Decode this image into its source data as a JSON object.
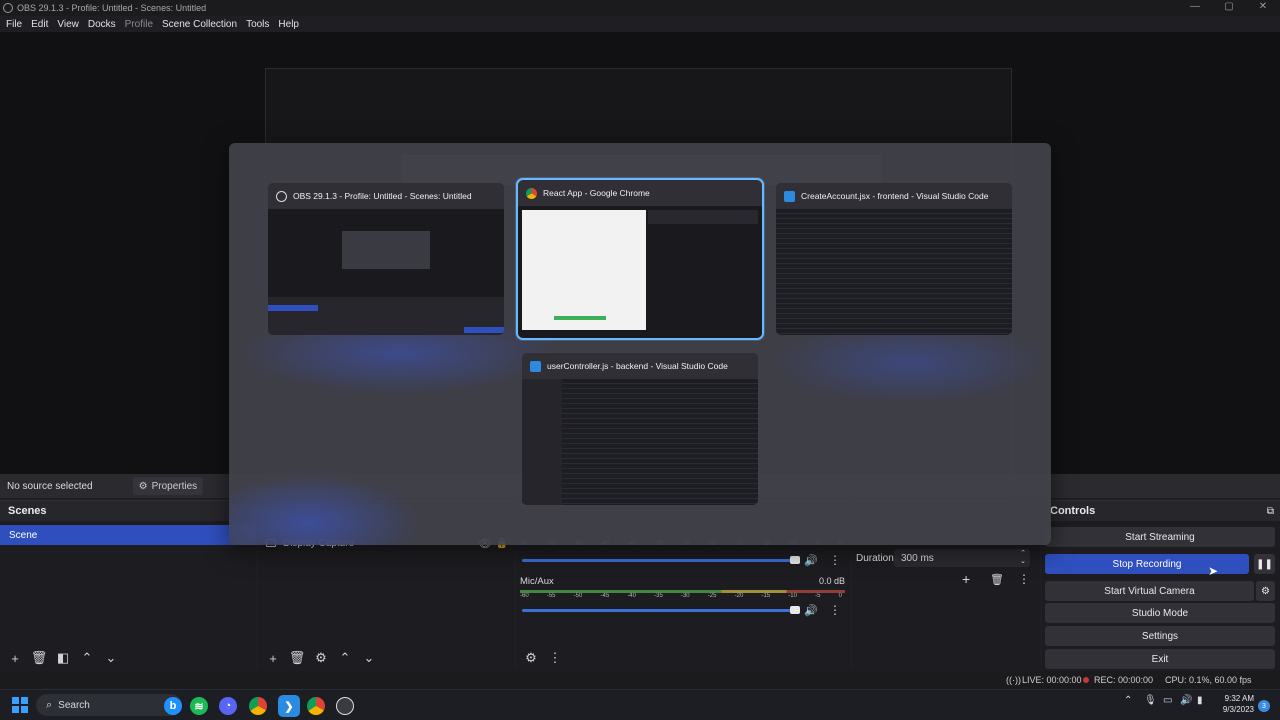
{
  "window": {
    "title": "OBS 29.1.3 - Profile: Untitled - Scenes: Untitled",
    "controls": [
      "—",
      "▢",
      "✕"
    ]
  },
  "menu": [
    "File",
    "Edit",
    "View",
    "Docks",
    "Profile",
    "Scene Collection",
    "Tools",
    "Help"
  ],
  "source_bar": {
    "no_source": "No source selected",
    "properties_label": "Properties"
  },
  "scenes": {
    "header": "Scenes",
    "items": [
      "Scene"
    ]
  },
  "sources": {
    "items": [
      "Display Capture"
    ]
  },
  "mixer": {
    "ticks": [
      "-60",
      "-55",
      "-50",
      "-45",
      "-40",
      "-35",
      "-30",
      "-25",
      "-20",
      "-15",
      "-10",
      "-5",
      "0"
    ],
    "channels": [
      {
        "name": "Mic/Aux",
        "level": "0.0 dB"
      }
    ]
  },
  "transitions": {
    "duration_label": "Duration",
    "duration_value": "300 ms"
  },
  "controls": {
    "header": "Controls",
    "start_streaming": "Start Streaming",
    "stop_recording": "Stop Recording",
    "start_virtual_camera": "Start Virtual Camera",
    "studio_mode": "Studio Mode",
    "settings": "Settings",
    "exit": "Exit"
  },
  "status": {
    "live": "LIVE: 00:00:00",
    "rec": "REC: 00:00:00",
    "cpu": "CPU: 0.1%, 60.00 fps"
  },
  "taskbar": {
    "search_label": "Search",
    "time": "9:32 AM",
    "date": "9/3/2023",
    "notification_count": "3"
  },
  "switcher": {
    "windows": [
      {
        "title": "OBS 29.1.3 - Profile: Untitled - Scenes: Untitled",
        "icon": "obs-icon"
      },
      {
        "title": "React App - Google Chrome",
        "icon": "chrome-icon"
      },
      {
        "title": "CreateAccount.jsx - frontend - Visual Studio Code",
        "icon": "vscode-icon"
      },
      {
        "title": "userController.js - backend - Visual Studio Code",
        "icon": "vscode-icon"
      }
    ]
  },
  "colors": {
    "accent": "#2f4fbf",
    "selection_outline": "#6ab8ff",
    "vscode": "#2a8be0"
  }
}
